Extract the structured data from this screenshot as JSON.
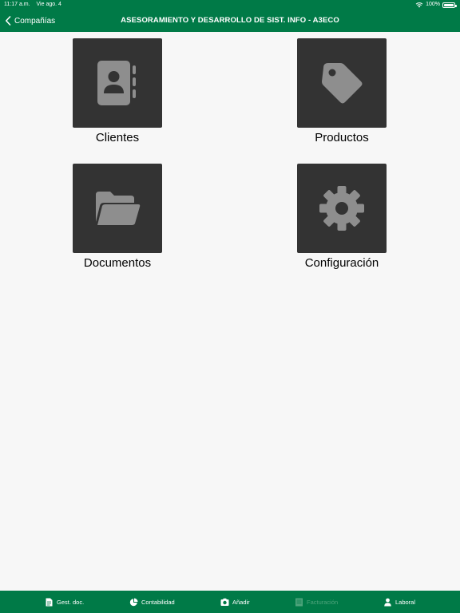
{
  "status": {
    "time": "11:17 a.m.",
    "date": "Vie ago. 4",
    "battery": "100%"
  },
  "nav": {
    "back_label": "Compañías",
    "title": "ASESORAMIENTO Y DESARROLLO DE SIST. INFO - A3ECO"
  },
  "tiles": [
    {
      "label": "Clientes",
      "icon": "contacts-icon"
    },
    {
      "label": "Productos",
      "icon": "tag-icon"
    },
    {
      "label": "Documentos",
      "icon": "folder-icon"
    },
    {
      "label": "Configuración",
      "icon": "gear-icon"
    }
  ],
  "tabs": [
    {
      "label": "Gest. doc.",
      "icon": "document-icon",
      "enabled": true
    },
    {
      "label": "Contabilidad",
      "icon": "pie-chart-icon",
      "enabled": true
    },
    {
      "label": "Añadir",
      "icon": "camera-icon",
      "enabled": true
    },
    {
      "label": "Facturación",
      "icon": "invoice-icon",
      "enabled": false
    },
    {
      "label": "Laboral",
      "icon": "person-icon",
      "enabled": true
    }
  ],
  "colors": {
    "brand": "#007a47",
    "tile": "#333333",
    "icon": "#8e8e8e",
    "background": "#f7f7f7"
  }
}
